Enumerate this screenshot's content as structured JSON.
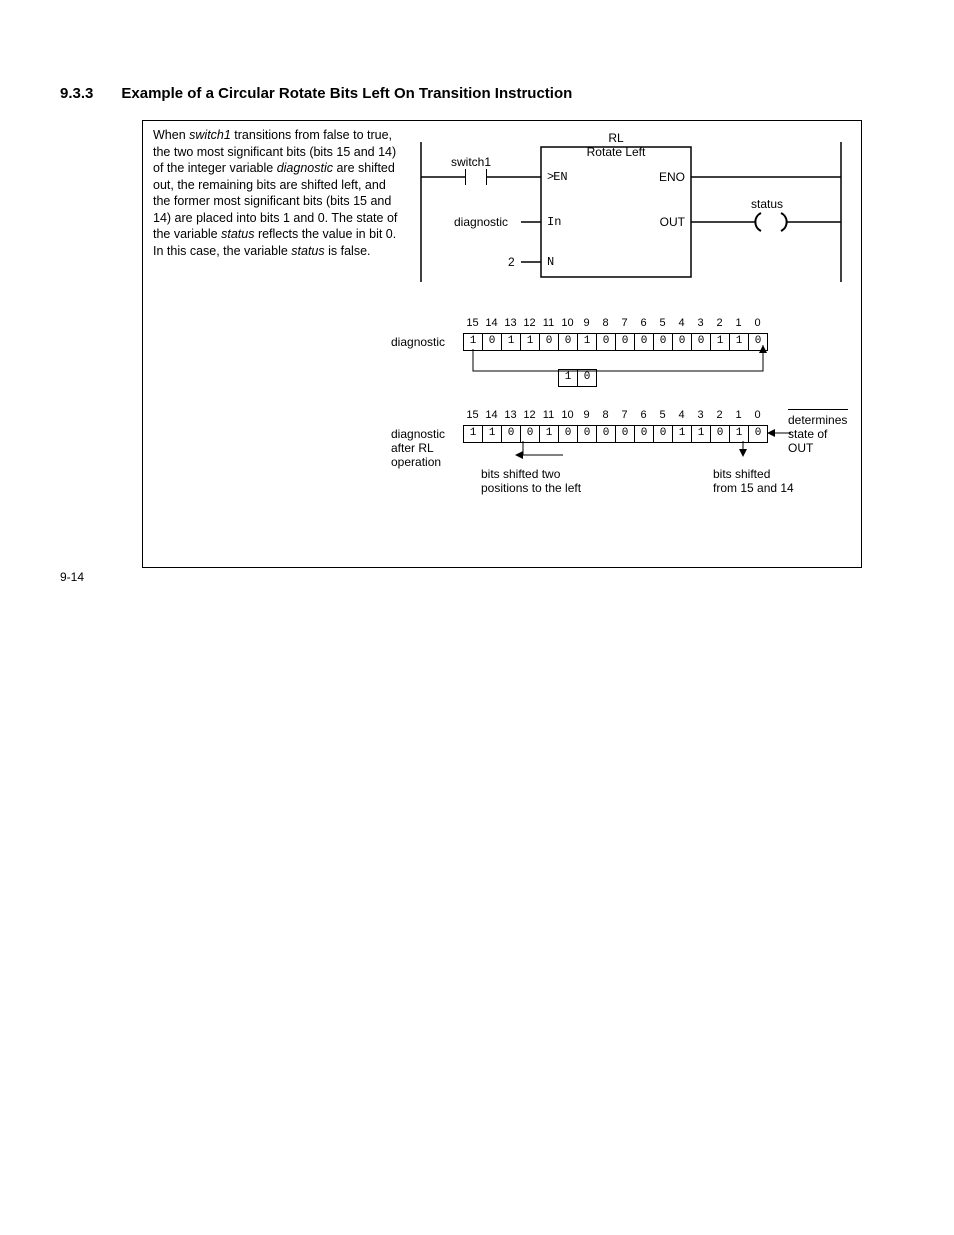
{
  "section_number": "9.3.3",
  "section_title": "Example of a Circular Rotate Bits Left On Transition Instruction",
  "desc": {
    "pre1": "When ",
    "em1": "switch1",
    "mid1": " transitions from false to true, the two most significant bits (bits 15 and 14) of the integer variable ",
    "em2": "diagnostic",
    "mid2": " are shifted out, the remaining bits are shifted left, and the former most significant bits (bits 15 and 14) are placed into bits 1 and 0. The state of the variable ",
    "em3": "status",
    "mid3": " reflects the value in bit 0. In this case, the variable ",
    "em4": "status",
    "post": " is false."
  },
  "ladder": {
    "block_title1": "RL",
    "block_title2": "Rotate Left",
    "en": "EN",
    "eno": "ENO",
    "in": "In",
    "out": "OUT",
    "n": "N",
    "switch1": "switch1",
    "diagnostic": "diagnostic",
    "two": "2",
    "status": "status"
  },
  "bits_area": {
    "label_diag": "diagnostic",
    "label_after1": "diagnostic",
    "label_after2": "after RL",
    "label_after3": "operation",
    "indices": [
      "15",
      "14",
      "13",
      "12",
      "11",
      "10",
      "9",
      "8",
      "7",
      "6",
      "5",
      "4",
      "3",
      "2",
      "1",
      "0"
    ],
    "row1": [
      "1",
      "0",
      "1",
      "1",
      "0",
      "0",
      "1",
      "0",
      "0",
      "0",
      "0",
      "0",
      "0",
      "1",
      "1",
      "0"
    ],
    "row_mid": "0",
    "row2": [
      "1",
      "1",
      "0",
      "0",
      "1",
      "0",
      "0",
      "0",
      "0",
      "0",
      "0",
      "1",
      "1",
      "0",
      "1",
      "0"
    ],
    "ann_left1": "bits shifted two",
    "ann_left2": "positions to the left",
    "ann_right1": "bits shifted",
    "ann_right2": "from 15 and 14",
    "ann_det1": "determines",
    "ann_det2": "state of",
    "ann_det3": "OUT"
  },
  "page_number": "9-14"
}
